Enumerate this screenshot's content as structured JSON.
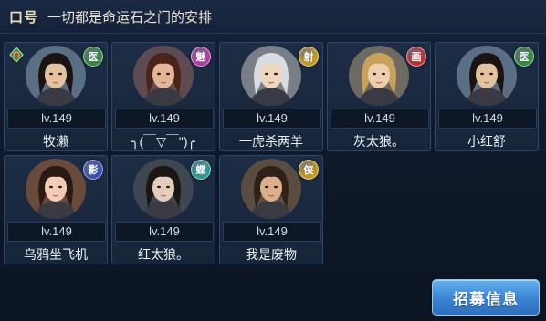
{
  "slogan": {
    "label": "口号",
    "text": "一切都是命运石之门的安排"
  },
  "members": [
    {
      "level": "lv.149",
      "name": "牧濑",
      "badge": "医",
      "badge_color": "#2f8a3c",
      "hair": "#1c1410",
      "skin": "#e5c2a0",
      "bg": "#5a6e86",
      "leader": true
    },
    {
      "level": "lv.149",
      "name": "╮(￣▽￣\")╭",
      "badge": "魅",
      "badge_color": "#b23aa8",
      "hair": "#4a2418",
      "skin": "#e3b796",
      "bg": "#5e4a52",
      "leader": false
    },
    {
      "level": "lv.149",
      "name": "一虎杀两羊",
      "badge": "射",
      "badge_color": "#c79a1e",
      "hair": "#d9dde2",
      "skin": "#efd6bd",
      "bg": "#7a7e86",
      "leader": false
    },
    {
      "level": "lv.149",
      "name": "灰太狼。",
      "badge": "画",
      "badge_color": "#c2302e",
      "hair": "#c8a25a",
      "skin": "#edcfb0",
      "bg": "#6d6a62",
      "leader": false
    },
    {
      "level": "lv.149",
      "name": "小红舒",
      "badge": "医",
      "badge_color": "#2f8a3c",
      "hair": "#1c1410",
      "skin": "#e5c2a0",
      "bg": "#5a6e86",
      "leader": false
    },
    {
      "level": "lv.149",
      "name": "乌鸦坐飞机",
      "badge": "影",
      "badge_color": "#3a4fb8",
      "hair": "#2a1a14",
      "skin": "#f0cdb4",
      "bg": "#6a4a3a",
      "leader": false
    },
    {
      "level": "lv.149",
      "name": "红太狼。",
      "badge": "蝶",
      "badge_color": "#2a9a8a",
      "hair": "#1a1614",
      "skin": "#e2cdbf",
      "bg": "#3e4650",
      "leader": false
    },
    {
      "level": "lv.149",
      "name": "我是废物",
      "badge": "侠",
      "badge_color": "#c7981a",
      "hair": "#2e2218",
      "skin": "#dcb08a",
      "bg": "#5a4c3e",
      "leader": false
    }
  ],
  "recruit_button": "招募信息"
}
